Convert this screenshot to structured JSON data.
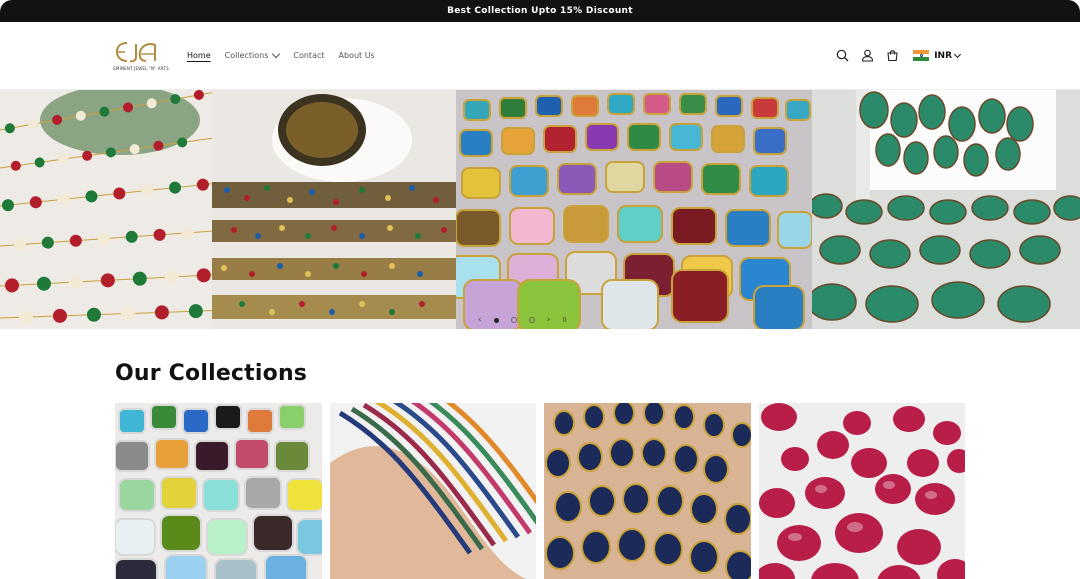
{
  "announcement": "Best Collection Upto 15% Discount",
  "logo": {
    "mark": "EJA",
    "tagline": "EMINENT JEWEL \"N\" ARTS"
  },
  "nav": [
    {
      "label": "Home",
      "active": true
    },
    {
      "label": "Collections",
      "dropdown": true
    },
    {
      "label": "Contact"
    },
    {
      "label": "About Us"
    }
  ],
  "header_icons": [
    "search-icon",
    "account-icon",
    "cart-icon"
  ],
  "currency": {
    "code": "INR",
    "flag": "india-flag-icon"
  },
  "slideshow": {
    "prev": "‹",
    "next": "›",
    "pause": "II",
    "slides": 3,
    "active": 1
  },
  "collections": {
    "title": "Our Collections",
    "cards": [
      {
        "name": "collection-card-connectors"
      },
      {
        "name": "collection-card-beads"
      },
      {
        "name": "collection-card-bezel-chain"
      },
      {
        "name": "collection-card-cabochons"
      }
    ]
  },
  "colors": {
    "bar": "#121212",
    "gold": "#b08a3e",
    "text": "#121212"
  }
}
